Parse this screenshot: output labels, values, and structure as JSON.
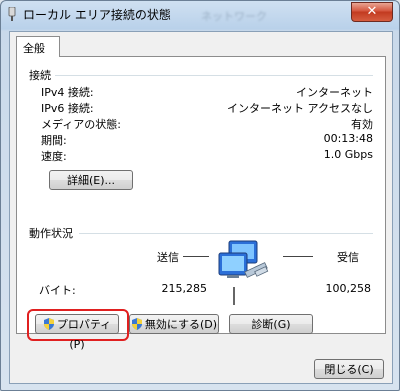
{
  "window": {
    "title": "ローカル エリア接続の状態",
    "background_title": "ネットワーク",
    "close_glyph": "✕"
  },
  "tabs": [
    {
      "label": "全般"
    }
  ],
  "connection": {
    "heading": "接続",
    "rows": [
      {
        "label": "IPv4 接続:",
        "value": "インターネット"
      },
      {
        "label": "IPv6 接続:",
        "value": "インターネット アクセスなし"
      },
      {
        "label": "メディアの状態:",
        "value": "有効"
      },
      {
        "label": "期間:",
        "value": "00:13:48"
      },
      {
        "label": "速度:",
        "value": "1.0 Gbps"
      }
    ],
    "details_button": "詳細(E)..."
  },
  "activity": {
    "heading": "動作状況",
    "sent_label": "送信",
    "received_label": "受信",
    "bytes_label": "バイト:",
    "sent_value": "215,285",
    "received_value": "100,258"
  },
  "buttons": {
    "properties": "プロパティ(P)",
    "disable": "無効にする(D)",
    "diagnose": "診断(G)",
    "close": "閉じる(C)"
  },
  "colors": {
    "highlight": "#e02020",
    "titlebar": "#b9d1ea"
  }
}
